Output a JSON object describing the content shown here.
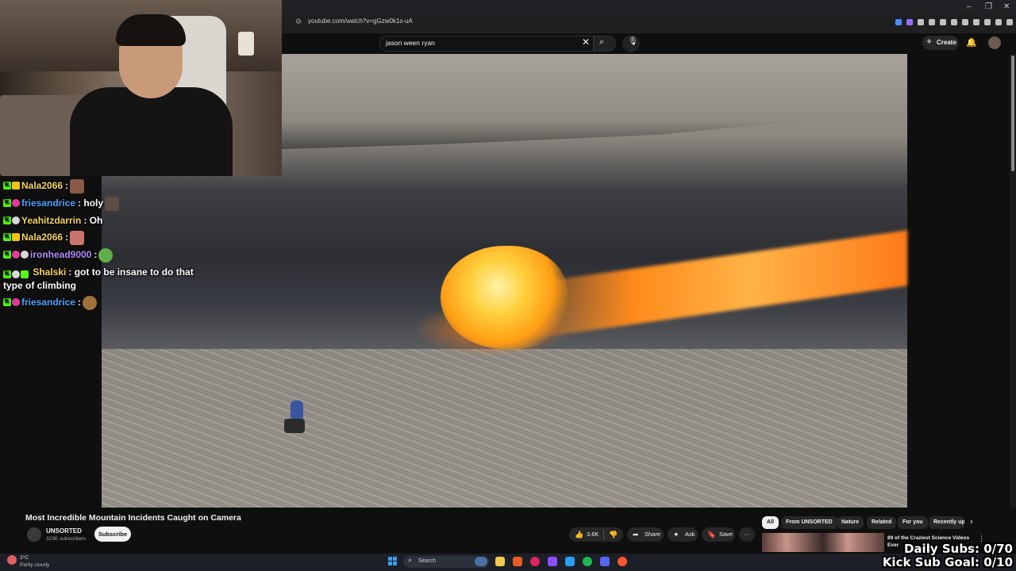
{
  "browser": {
    "url": "youtube.com/watch?v=gGzw0k1s-uA",
    "window_controls": [
      "–",
      "❐",
      "✕"
    ]
  },
  "youtube_header": {
    "search_value": "jason ween ryan",
    "create_label": "Create"
  },
  "chat": {
    "messages": [
      {
        "user": "Nala2066",
        "user_color": "#f4d35e",
        "text": "",
        "emote": true
      },
      {
        "user": "friesandrice",
        "user_color": "#4aa3ff",
        "text": "holy",
        "emote": true
      },
      {
        "user": "Yeahitzdarrin",
        "user_color": "#f4d35e",
        "text": "Oh",
        "emote": false
      },
      {
        "user": "Nala2066",
        "user_color": "#f4d35e",
        "text": "",
        "emote": true
      },
      {
        "user": "ironhead9000",
        "user_color": "#b28bff",
        "text": "",
        "emote": true
      },
      {
        "user": "Shalski",
        "user_color": "#f4d35e",
        "text": "got to be insane to do that type of climbing",
        "emote": false
      },
      {
        "user": "friesandrice",
        "user_color": "#4aa3ff",
        "text": "",
        "emote": true
      }
    ]
  },
  "video": {
    "title": "Most Incredible Mountain Incidents Caught on Camera",
    "channel": "UNSORTED",
    "subscribers": "323K subscribers",
    "subscribe_label": "Subscribe",
    "likes": "3.6K",
    "share_label": "Share",
    "ask_label": "Ask",
    "save_label": "Save",
    "more_label": "···"
  },
  "chips": [
    "All",
    "From UNSORTED",
    "Nature",
    "Related",
    "For you",
    "Recently up"
  ],
  "recommendation": {
    "title": "89 of the Craziest Science Videos Ever"
  },
  "taskbar": {
    "weather_temp": "3°C",
    "weather_desc": "Partly cloudy",
    "search_label": "Search"
  },
  "overlay": {
    "daily_subs": "Daily Subs: 0/70",
    "kick_sub_goal": "Kick Sub Goal: 0/10"
  },
  "colors": {
    "kick_green": "#53fc18",
    "yt_bg": "#0f0f0f"
  }
}
